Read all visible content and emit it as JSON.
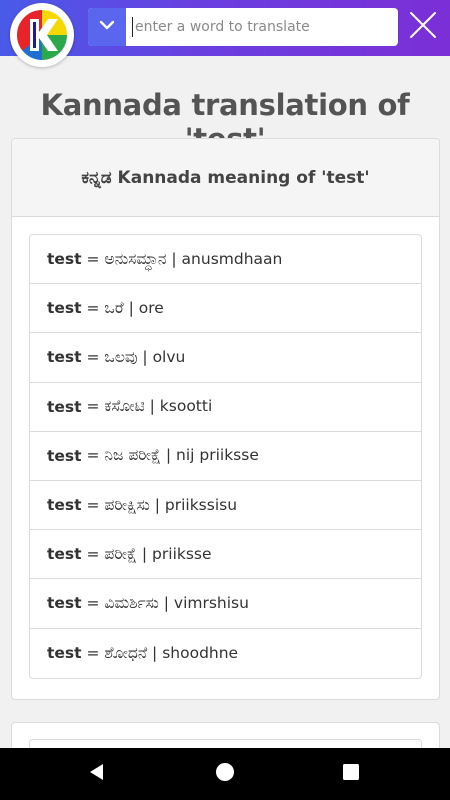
{
  "header": {
    "search_placeholder": "enter a word to translate",
    "logo_letter": "K"
  },
  "page": {
    "title": "Kannada translation of 'test'"
  },
  "meaning_card": {
    "header": "ಕನ್ನಡ Kannada meaning of 'test'",
    "items": [
      {
        "word": "test",
        "rest": " = ಅನುಸಮ್ಧಾನ | anusmdhaan"
      },
      {
        "word": "test",
        "rest": " = ಒರೆ | ore"
      },
      {
        "word": "test",
        "rest": " = ಒಲವು | olvu"
      },
      {
        "word": "test",
        "rest": " = ಕಸೋಟಿ | ksootti"
      },
      {
        "word": "test",
        "rest": " = ನಿಜ ಪರೀಕ್ಷೆ | nij priiksse"
      },
      {
        "word": "test",
        "rest": " = ಪರೀಕ್ಷಿಸು | priikssisu"
      },
      {
        "word": "test",
        "rest": " = ಪರೀಕ್ಷೆ | priiksse"
      },
      {
        "word": "test",
        "rest": " = ವಿಮರ್ಶಿಸು | vimrshisu"
      },
      {
        "word": "test",
        "rest": " = ಶೋಧನೆ | shoodhne"
      }
    ]
  },
  "colors": {
    "header_start": "#4a5ae8",
    "header_end": "#7b2fd6",
    "dropdown_bg": "#5b66ee",
    "title_text": "#545454"
  },
  "icons": {
    "dropdown": "chevron-down-icon",
    "close": "close-icon",
    "back": "back-icon",
    "home": "home-icon",
    "recents": "recents-icon"
  }
}
